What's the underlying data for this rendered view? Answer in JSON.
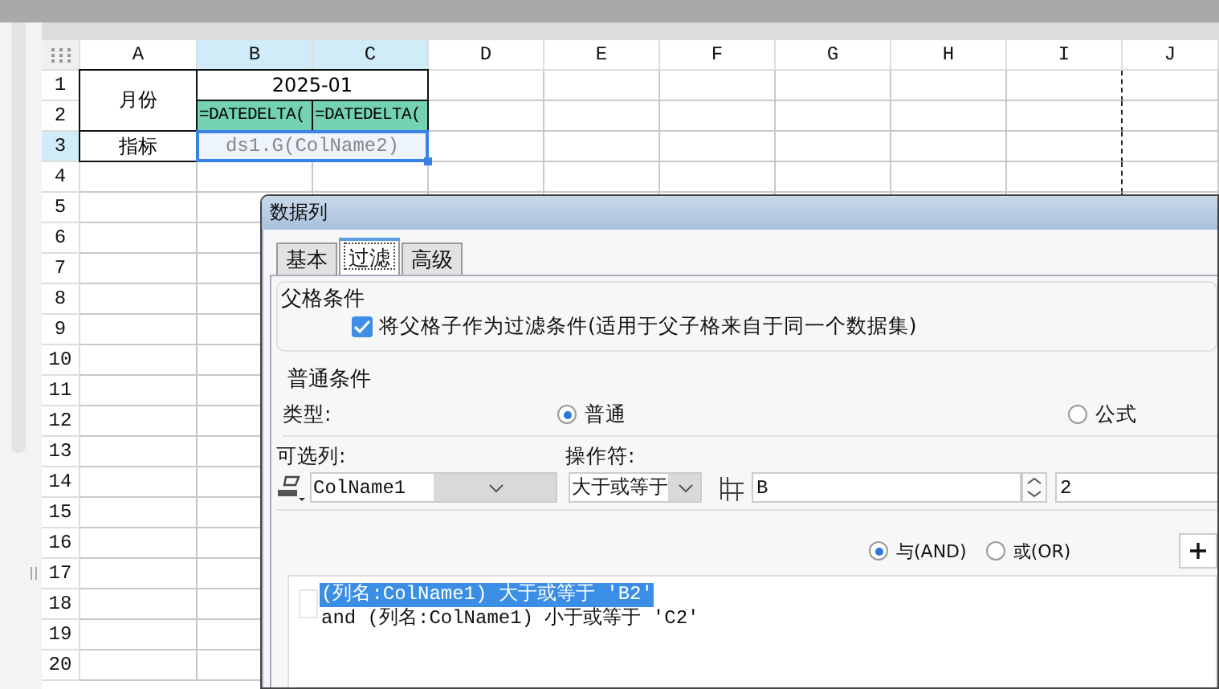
{
  "sheet": {
    "columns": [
      {
        "label": "A",
        "selected": false
      },
      {
        "label": "B",
        "selected": true
      },
      {
        "label": "C",
        "selected": true
      },
      {
        "label": "D",
        "selected": false
      },
      {
        "label": "E",
        "selected": false
      },
      {
        "label": "F",
        "selected": false
      },
      {
        "label": "G",
        "selected": false
      },
      {
        "label": "H",
        "selected": false
      },
      {
        "label": "I",
        "selected": false
      },
      {
        "label": "J",
        "selected": false
      }
    ],
    "rows": [
      {
        "label": "1",
        "selected": false
      },
      {
        "label": "2",
        "selected": false
      },
      {
        "label": "3",
        "selected": true
      },
      {
        "label": "4",
        "selected": false
      },
      {
        "label": "5",
        "selected": false
      },
      {
        "label": "6",
        "selected": false
      },
      {
        "label": "7",
        "selected": false
      },
      {
        "label": "8",
        "selected": false
      },
      {
        "label": "9",
        "selected": false
      },
      {
        "label": "10",
        "selected": false
      },
      {
        "label": "11",
        "selected": false
      },
      {
        "label": "12",
        "selected": false
      },
      {
        "label": "13",
        "selected": false
      },
      {
        "label": "14",
        "selected": false
      },
      {
        "label": "15",
        "selected": false
      },
      {
        "label": "16",
        "selected": false
      },
      {
        "label": "17",
        "selected": false
      },
      {
        "label": "18",
        "selected": false
      },
      {
        "label": "19",
        "selected": false
      },
      {
        "label": "20",
        "selected": false
      }
    ],
    "cells": [
      {
        "text": "月份",
        "kind": "label",
        "selected": false
      },
      {
        "text": "2025-01",
        "kind": "label",
        "selected": false
      },
      {
        "text": "=DATEDELTA(",
        "kind": "formula",
        "selected": false
      },
      {
        "text": "=DATEDELTA(",
        "kind": "formula",
        "selected": false
      },
      {
        "text": "指标",
        "kind": "label",
        "selected": false
      },
      {
        "text": "ds1.G(ColName2)",
        "kind": "data",
        "selected": true
      }
    ]
  },
  "dialog": {
    "title": "数据列",
    "tabs": [
      {
        "label": "基本",
        "selected": false
      },
      {
        "label": "过滤",
        "selected": true
      },
      {
        "label": "高级",
        "selected": false
      }
    ],
    "parent_condition": {
      "heading": "父格条件",
      "checkbox": {
        "label": "将父格子作为过滤条件(适用于父子格来自于同一个数据集)",
        "checked": true
      }
    },
    "normal_condition": {
      "heading": "普通条件",
      "type_label": "类型:",
      "type_options": [
        {
          "label": "普通",
          "selected": true
        },
        {
          "label": "公式",
          "selected": false
        }
      ],
      "column_label": "可选列:",
      "operator_label": "操作符:",
      "column_value": "ColName1",
      "operator_value": "大于或等于",
      "value_field": "B",
      "value_field_2": "2",
      "logic_options": [
        {
          "label": "与(AND)",
          "selected": true
        },
        {
          "label": "或(OR)",
          "selected": false
        }
      ],
      "conditions": [
        {
          "text": "(列名:ColName1) 大于或等于 'B2'",
          "selected": true
        },
        {
          "text": "and (列名:ColName1) 小于或等于 'C2'",
          "selected": false
        }
      ]
    }
  }
}
